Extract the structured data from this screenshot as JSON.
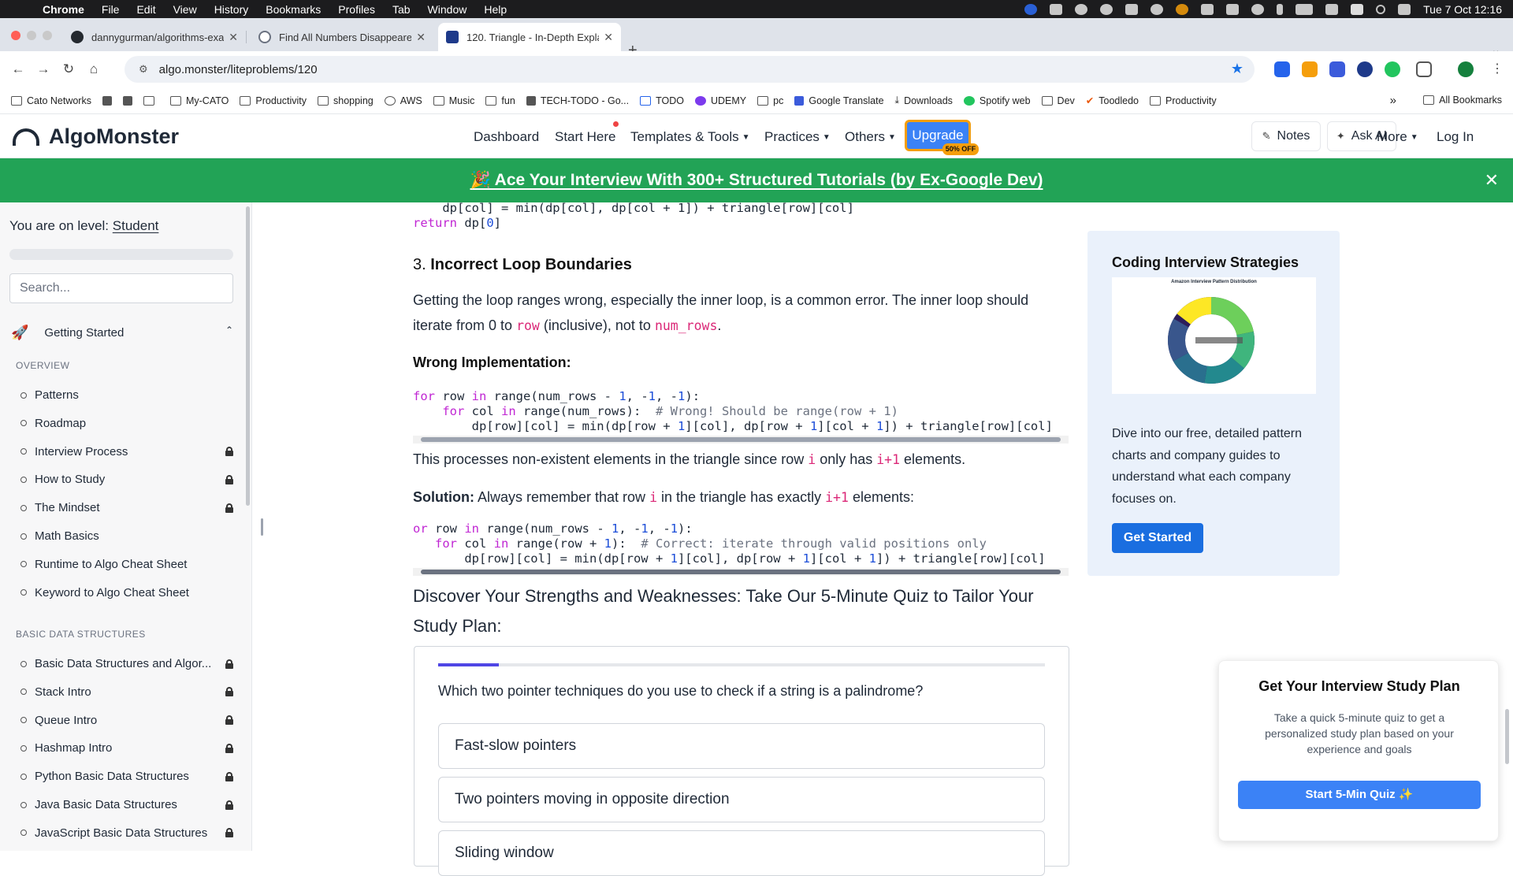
{
  "menubar": {
    "items": [
      "Chrome",
      "File",
      "Edit",
      "View",
      "History",
      "Bookmarks",
      "Profiles",
      "Tab",
      "Window",
      "Help"
    ],
    "clock": "Tue 7 Oct  12:16"
  },
  "tabs": [
    {
      "title": "dannygurman/algorithms-exa",
      "favicon_color": "#24292f"
    },
    {
      "title": "Find All Numbers Disappeare",
      "favicon_color": "#6b7280"
    },
    {
      "title": "120. Triangle - In-Depth Expla",
      "favicon_color": "#1e3a8a"
    }
  ],
  "url": "algo.monster/liteproblems/120",
  "bookmarks": [
    "Cato Networks",
    "My-CATO",
    "Productivity",
    "shopping",
    "AWS",
    "Music",
    "fun",
    "TECH-TODO - Go...",
    "TODO",
    "UDEMY",
    "pc",
    "Google Translate",
    "Downloads",
    "Spotify web",
    "Dev",
    "Toodledo",
    "Productivity"
  ],
  "all_bookmarks": "All Bookmarks",
  "site": {
    "logo": "AlgoMonster",
    "nav": [
      "Dashboard",
      "Start Here",
      "Templates & Tools",
      "Practices",
      "Others"
    ],
    "upgrade": "Upgrade",
    "upgrade_badge": "50% OFF",
    "notes": "Notes",
    "ask_ai": "Ask AI",
    "more": "More",
    "login": "Log In"
  },
  "banner": "🎉 Ace Your Interview With 300+ Structured Tutorials (by Ex-Google Dev)",
  "sidebar": {
    "level_prefix": "You are on level:",
    "level": "Student",
    "search_placeholder": "Search...",
    "group": "Getting Started",
    "overview_heading": "OVERVIEW",
    "overview_items": [
      {
        "label": "Patterns",
        "locked": false
      },
      {
        "label": "Roadmap",
        "locked": false
      },
      {
        "label": "Interview Process",
        "locked": true
      },
      {
        "label": "How to Study",
        "locked": true
      },
      {
        "label": "The Mindset",
        "locked": true
      },
      {
        "label": "Math Basics",
        "locked": false
      },
      {
        "label": "Runtime to Algo Cheat Sheet",
        "locked": false
      },
      {
        "label": "Keyword to Algo Cheat Sheet",
        "locked": false
      }
    ],
    "basic_heading": "BASIC DATA STRUCTURES",
    "basic_items": [
      {
        "label": "Basic Data Structures and Algor...",
        "locked": true
      },
      {
        "label": "Stack Intro",
        "locked": true
      },
      {
        "label": "Queue Intro",
        "locked": true
      },
      {
        "label": "Hashmap Intro",
        "locked": true
      },
      {
        "label": "Python Basic Data Structures",
        "locked": true
      },
      {
        "label": "Java Basic Data Structures",
        "locked": true
      },
      {
        "label": "JavaScript Basic Data Structures",
        "locked": true
      }
    ]
  },
  "article": {
    "code_top_1": "    dp[col] = min(dp[col], dp[col + 1]) + triangle[row][col]",
    "code_top_2": "return dp[0]",
    "section_num": "3.",
    "section_title": "Incorrect Loop Boundaries",
    "para1_a": "Getting the loop ranges wrong, especially the inner loop, is a common error. The inner loop should iterate from 0 to ",
    "para1_code1": "row",
    "para1_b": " (inclusive), not to ",
    "para1_code2": "num_rows",
    "para1_c": ".",
    "wrong_heading": "Wrong Implementation:",
    "wrong_code": [
      "for row in range(num_rows - 1, -1, -1):",
      "    for col in range(num_rows):  # Wrong! Should be range(row + 1)",
      "        dp[row][col] = min(dp[row + 1][col], dp[row + 1][col + 1]) + triangle[row][col]"
    ],
    "para2_a": "This processes non-existent elements in the triangle since row ",
    "para2_code1": "i",
    "para2_b": " only has ",
    "para2_code2": "i+1",
    "para2_c": " elements.",
    "solution_label": "Solution:",
    "solution_a": " Always remember that row ",
    "solution_code1": "i",
    "solution_b": " in the triangle has exactly ",
    "solution_code2": "i+1",
    "solution_c": " elements:",
    "fixed_code": [
      "or row in range(num_rows - 1, -1, -1):",
      "   for col in range(row + 1):  # Correct: iterate through valid positions only",
      "       dp[row][col] = min(dp[row + 1][col], dp[row + 1][col + 1]) + triangle[row][col]"
    ]
  },
  "quiz": {
    "heading": "Discover Your Strengths and Weaknesses: Take Our 5-Minute Quiz to Tailor Your Study Plan:",
    "progress": 0.1,
    "question": "Which two pointer techniques do you use to check if a string is a palindrome?",
    "options": [
      "Fast-slow pointers",
      "Two pointers moving in opposite direction",
      "Sliding window"
    ]
  },
  "strategies": {
    "title": "Coding Interview Strategies",
    "chart_title": "Amazon Interview Pattern Distribution",
    "description": "Dive into our free, detailed pattern charts and company guides to understand what each company focuses on.",
    "button": "Get Started"
  },
  "popup": {
    "title": "Get Your Interview Study Plan",
    "description": "Take a quick 5-minute quiz to get a personalized study plan based on your experience and goals",
    "button": "Start 5-Min Quiz ✨"
  },
  "colors": {
    "brand_green": "#22a356",
    "accent_blue": "#3b82f6",
    "inline_code": "#db2777"
  }
}
